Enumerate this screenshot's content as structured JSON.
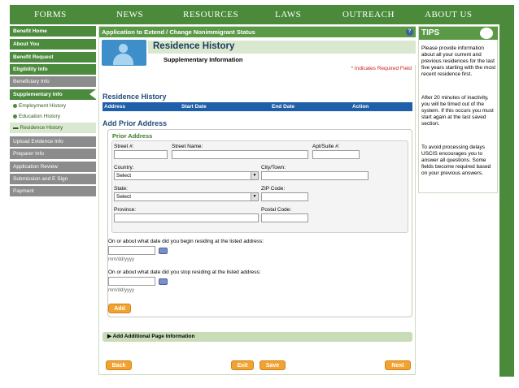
{
  "nav": {
    "items": [
      "FORMS",
      "NEWS",
      "RESOURCES",
      "LAWS",
      "OUTREACH",
      "ABOUT US"
    ]
  },
  "sidebar": {
    "items": [
      {
        "label": "Benefit Home",
        "style": "green"
      },
      {
        "label": "About You",
        "style": "green"
      },
      {
        "label": "Benefit Request",
        "style": "green"
      },
      {
        "label": "Eligibility Info",
        "style": "green"
      },
      {
        "label": "Beneficiary Info",
        "style": "gray"
      },
      {
        "label": "Supplementary Info",
        "style": "green-active"
      },
      {
        "label": "Employment History",
        "style": "sub"
      },
      {
        "label": "Education History",
        "style": "sub"
      },
      {
        "label": "Residence History",
        "style": "sub-active"
      },
      {
        "label": "Upload Evidence Info",
        "style": "gray"
      },
      {
        "label": "Preparer Info",
        "style": "gray"
      },
      {
        "label": "Application Review",
        "style": "gray"
      },
      {
        "label": "Submission and E Sign",
        "style": "gray"
      },
      {
        "label": "Payment",
        "style": "gray"
      }
    ]
  },
  "main": {
    "header": "Application to Extend / Change Nonimmigrant Status",
    "help": "?",
    "title": "Residence History",
    "subtitle": "Supplementary Information",
    "required_note": "* Indicates Required Field",
    "history_heading": "Residence History",
    "table_columns": [
      "Address",
      "Start Date",
      "End Date",
      "Action"
    ],
    "add_heading": "Add Prior Address",
    "prior_title": "Prior Address",
    "labels": {
      "street_no": "Street #:",
      "street_name": "Street Name:",
      "apt": "Apt/Suite #:",
      "country": "Country:",
      "city": "City/Town:",
      "state": "State:",
      "zip": "ZIP Code:",
      "province": "Province:",
      "postal": "Postal Code:"
    },
    "country_value": "Select",
    "state_value": "Select",
    "begin_question": "On or about what date did you begin residing at the listed address:",
    "stop_question": "On or about what date did you stop residing at the listed address:",
    "date_hint": "mm/dd/yyyy",
    "add_button": "Add",
    "add_page_info": "Add Additional Page Information",
    "add_page_arrow": "▶",
    "back_button": "Back",
    "exit_button": "Exit",
    "save_button": "Save",
    "next_button": "Next"
  },
  "tips": {
    "header": "TIPS",
    "paragraphs": [
      "Please provide information about all your current and previous residences for the last five years starting with the most recent residence first.",
      "After 20 minutes of inactivity, you will be timed out of the system. If this occurs you must start again at the last saved section.",
      "To avoid processing delays USCIS encourages you to answer all questions. Some fields become required based on your previous answers."
    ]
  },
  "colors": {
    "brand_green": "#4a8a3a",
    "header_green": "#5a9a46",
    "table_blue": "#1f5ea8",
    "button_orange": "#f2a230",
    "required_red": "#cc2222"
  }
}
